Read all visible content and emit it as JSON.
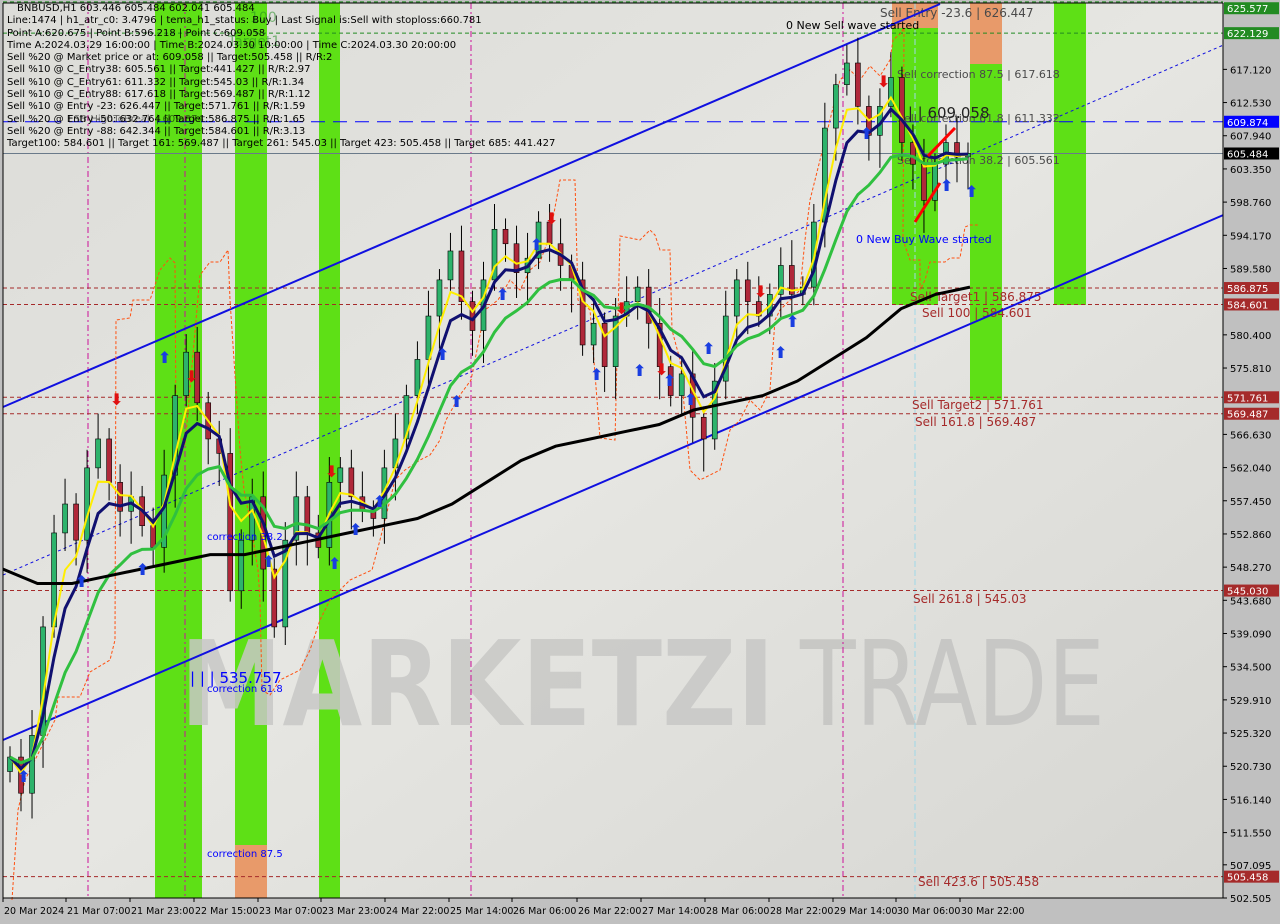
{
  "header": {
    "symbol_line": "BNBUSD,H1  603.446 605.484 602.041 605.484"
  },
  "info_lines": [
    "Line:1474 | h1_atr_c0: 3.4796 | tema_h1_status: Buy | Last Signal is:Sell with stoploss:660.781",
    "Point A:620.675 | Point B:596.218 | Point C:609.058",
    "Time A:2024.03.29 16:00:00 | Time B:2024.03.30 10:00:00 | Time C:2024.03.30 20:00:00",
    "Sell %20 @ Market price or at: 609.058 || Target:505.458 || R/R:2",
    "Sell %10 @ C_Entry38: 605.561 || Target:441.427 || R/R:2.97",
    "Sell %10 @ C_Entry61: 611.332 || Target:545.03 || R/R:1.34",
    "Sell %10 @ C_Entry88: 617.618 || Target:569.487 || R/R:1.12",
    "Sell %10 @ Entry -23: 626.447 || Target:571.761 || R/R:1.59",
    "Sell %20 @ Entry -50: 632.764 || Target:586.875 || R/R:1.65",
    "Sell %20 @ Entry -88: 642.344 || Target:584.601 || R/R:3.13",
    "Target100: 584.601 || Target 161: 569.487 || Target 261: 545.03 || Target 423: 505.458 || Target 685: 441.427"
  ],
  "watermark": {
    "left": "MARKETZI",
    "right": "TRADE"
  },
  "colors": {
    "background": "#d8d8d4",
    "axis_panel": "#c0c0c0",
    "bull_candle": "#2db36b",
    "bear_candle": "#b0283a",
    "green_zone": "#5ee016",
    "orange_zone": "#e89a6a",
    "channel": "#1010e0",
    "ema_navy": "#101070",
    "ema_yellow": "#ffee00",
    "ema_green": "#30c040",
    "ema_black": "#000000",
    "level_red": "#a52a2a",
    "level_green": "#228b22",
    "level_blue": "#0000ff"
  },
  "chart_data": {
    "type": "candlestick",
    "title": "BNBUSD,H1",
    "ohlc_last": {
      "open": 603.446,
      "high": 605.484,
      "low": 602.041,
      "close": 605.484
    },
    "ylim": [
      502.505,
      626.3
    ],
    "y_ticks": [
      625.577,
      622.129,
      617.12,
      612.53,
      609.874,
      607.94,
      605.484,
      603.35,
      598.76,
      594.17,
      589.58,
      586.875,
      584.601,
      580.4,
      575.81,
      571.761,
      569.487,
      566.63,
      562.04,
      557.45,
      552.86,
      548.27,
      545.03,
      543.68,
      539.09,
      534.5,
      529.91,
      525.32,
      520.73,
      516.14,
      511.55,
      507.095,
      505.458,
      502.505
    ],
    "y_tick_labels": [
      "625.577",
      "622.129",
      "617.120",
      "612.530",
      "609.874",
      "607.940",
      "605.484",
      "603.350",
      "598.760",
      "594.170",
      "589.580",
      "586.875",
      "584.601",
      "580.400",
      "575.810",
      "571.761",
      "569.487",
      "566.630",
      "562.040",
      "557.450",
      "552.860",
      "548.270",
      "545.030",
      "543.680",
      "539.090",
      "534.500",
      "529.910",
      "525.320",
      "520.730",
      "516.140",
      "511.550",
      "507.095",
      "505.458",
      "502.505"
    ],
    "price_tags": [
      {
        "value": 625.577,
        "label": "625.577",
        "color": "#228b22"
      },
      {
        "value": 622.129,
        "label": "622.129",
        "color": "#228b22"
      },
      {
        "value": 609.874,
        "label": "609.874",
        "color": "#0000ff"
      },
      {
        "value": 605.484,
        "label": "605.484",
        "color": "#000000"
      },
      {
        "value": 586.875,
        "label": "586.875",
        "color": "#a52a2a"
      },
      {
        "value": 584.601,
        "label": "584.601",
        "color": "#a52a2a"
      },
      {
        "value": 571.761,
        "label": "571.761",
        "color": "#a52a2a"
      },
      {
        "value": 569.487,
        "label": "569.487",
        "color": "#a52a2a"
      },
      {
        "value": 545.03,
        "label": "545.030",
        "color": "#a52a2a"
      },
      {
        "value": 505.458,
        "label": "505.458",
        "color": "#a52a2a"
      }
    ],
    "x_tick_labels": [
      "20 Mar 2024",
      "21 Mar 07:00",
      "21 Mar 23:00",
      "22 Mar 15:00",
      "23 Mar 07:00",
      "23 Mar 23:00",
      "24 Mar 22:00",
      "25 Mar 14:00",
      "26 Mar 06:00",
      "26 Mar 22:00",
      "27 Mar 14:00",
      "28 Mar 06:00",
      "28 Mar 22:00",
      "29 Mar 14:00",
      "30 Mar 06:00",
      "30 Mar 22:00"
    ],
    "levels": [
      {
        "value": 626.447,
        "label": "Sell Entry -23.6 | 626.447",
        "style": "green-dash"
      },
      {
        "value": 622.129,
        "label": "",
        "style": "green-dash"
      },
      {
        "value": 617.618,
        "label": "Sell correction 87.5 | 617.618",
        "style": "none"
      },
      {
        "value": 611.332,
        "label": "Sell correction 61.8 | 611.332",
        "style": "none"
      },
      {
        "value": 609.874,
        "label": "",
        "style": "blue-longdash"
      },
      {
        "value": 609.058,
        "label": "| | | 609.058",
        "style": "none"
      },
      {
        "value": 605.561,
        "label": "Sell correction 38.2 | 605.561",
        "style": "none"
      },
      {
        "value": 605.484,
        "label": "",
        "style": "gray-solid"
      },
      {
        "value": 586.875,
        "label": "Sell Target1 | 586.875",
        "style": "red-dash"
      },
      {
        "value": 584.601,
        "label": "Sell 100 | 584.601",
        "style": "red-dash"
      },
      {
        "value": 571.761,
        "label": "Sell Target2 | 571.761",
        "style": "red-dash"
      },
      {
        "value": 569.487,
        "label": "Sell 161.8 | 569.487",
        "style": "red-dash"
      },
      {
        "value": 545.03,
        "label": "Sell 261.8 | 545.03",
        "style": "red-dash"
      },
      {
        "value": 505.458,
        "label": "Sell 423.6 | 505.458",
        "style": "red-dash"
      }
    ],
    "annotations": [
      {
        "text": "0 New Sell wave started",
        "color": "#000000"
      },
      {
        "text": "0 New Buy Wave started",
        "color": "#0000ff"
      },
      {
        "text": "correction 38.2",
        "color": "#0000ff"
      },
      {
        "text": "| | | 535.757",
        "color": "#0000ff"
      },
      {
        "text": "correction 61.8",
        "color": "#0000ff"
      },
      {
        "text": "correction 87.5",
        "color": "#0000ff"
      },
      {
        "text": "100",
        "color": "#228b22"
      },
      {
        "text": "Target1",
        "color": "#228b22"
      },
      {
        "text": "FSB-HighToBreak | 609.874",
        "color": "#000000"
      }
    ],
    "series": [
      {
        "name": "close",
        "values": [
          522,
          517,
          525,
          540,
          553,
          557,
          552,
          562,
          566,
          560,
          556,
          558,
          554,
          551,
          561,
          572,
          578,
          571,
          566,
          564,
          545,
          552,
          558,
          548,
          540,
          552,
          558,
          553,
          551,
          560,
          562,
          558,
          556,
          555,
          562,
          566,
          572,
          577,
          583,
          588,
          592,
          585,
          581,
          588,
          595,
          593,
          589,
          591,
          596,
          593,
          590,
          588,
          579,
          582,
          576,
          583,
          585,
          587,
          582,
          576,
          572,
          575,
          569,
          566,
          574,
          583,
          588,
          585,
          583,
          586,
          590,
          586,
          587,
          596,
          609,
          615,
          618,
          612,
          608,
          612,
          616,
          607,
          604,
          599,
          604,
          607,
          605,
          605.5
        ]
      },
      {
        "name": "ema_200",
        "values": [
          548,
          546,
          546,
          547,
          548,
          549,
          550,
          550,
          551,
          552,
          553,
          554,
          555,
          557,
          560,
          563,
          565,
          566,
          567,
          568,
          570,
          571,
          572,
          574,
          577,
          580,
          584,
          586,
          587
        ]
      }
    ]
  }
}
